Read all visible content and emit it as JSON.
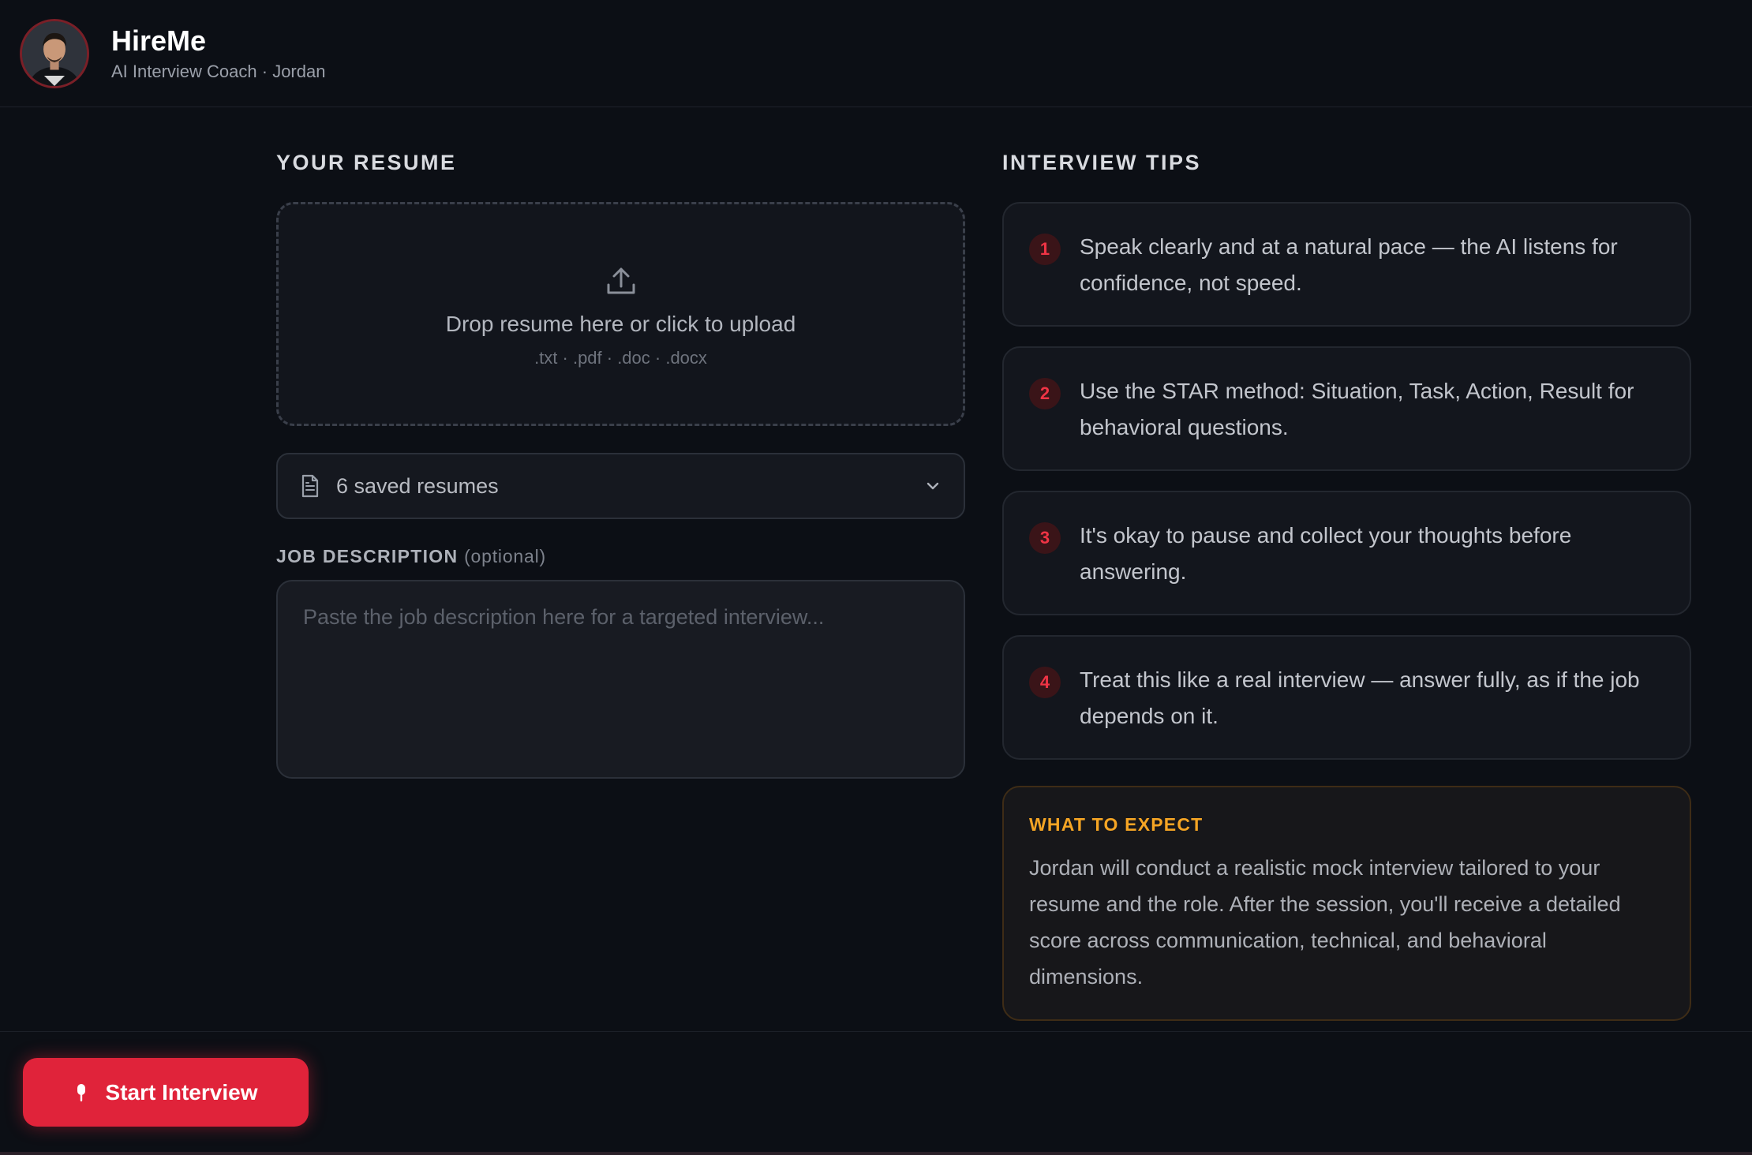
{
  "app": {
    "title": "HireMe",
    "subtitle": "AI Interview Coach · Jordan"
  },
  "resume": {
    "section_title": "YOUR RESUME",
    "dropzone_text": "Drop resume here or click to upload",
    "dropzone_formats": ".txt · .pdf · .doc · .docx",
    "saved_select_label": "6 saved resumes"
  },
  "job_description": {
    "title": "JOB DESCRIPTION",
    "optional": "(optional)",
    "placeholder": "Paste the job description here for a targeted interview..."
  },
  "tips": {
    "section_title": "INTERVIEW TIPS",
    "items": [
      {
        "num": "1",
        "text": "Speak clearly and at a natural pace — the AI listens for confidence, not speed."
      },
      {
        "num": "2",
        "text": "Use the STAR method: Situation, Task, Action, Result for behavioral questions."
      },
      {
        "num": "3",
        "text": "It's okay to pause and collect your thoughts before answering."
      },
      {
        "num": "4",
        "text": "Treat this like a real interview — answer fully, as if the job depends on it."
      }
    ]
  },
  "expect": {
    "title": "WHAT TO EXPECT",
    "text": "Jordan will conduct a realistic mock interview tailored to your resume and the role. After the session, you'll receive a detailed score across communication, technical, and behavioral dimensions."
  },
  "footer": {
    "start_label": "Start Interview"
  },
  "colors": {
    "accent": "#e0233a",
    "warning": "#f5a524",
    "background": "#0c0f15"
  },
  "icons": {
    "upload": "upload-icon",
    "document": "document-icon",
    "chevron": "chevron-down-icon",
    "mic": "microphone-icon"
  }
}
